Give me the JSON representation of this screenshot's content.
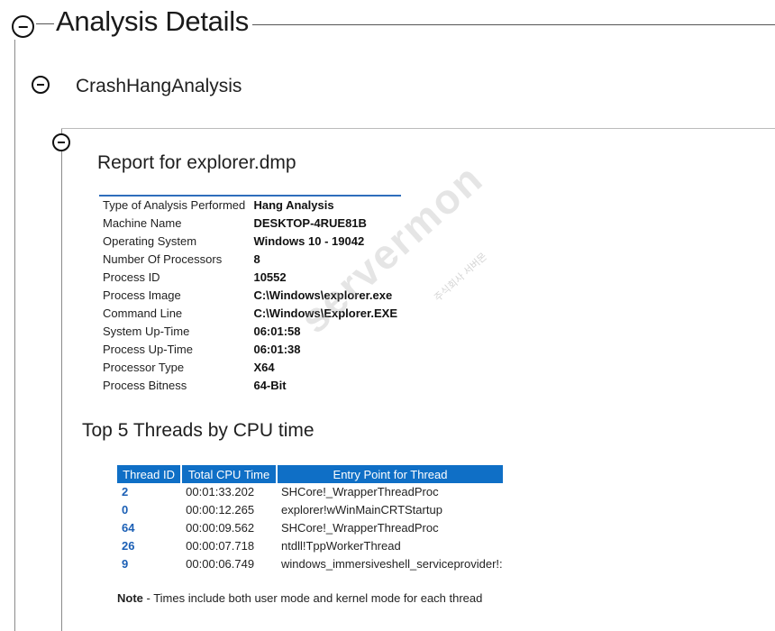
{
  "section": {
    "title": "Analysis Details",
    "subsection": "CrashHangAnalysis",
    "report_title": "Report for explorer.dmp"
  },
  "info": [
    {
      "label": "Type of Analysis Performed",
      "value": "Hang Analysis"
    },
    {
      "label": "Machine Name",
      "value": "DESKTOP-4RUE81B"
    },
    {
      "label": "Operating System",
      "value": "Windows 10 - 19042"
    },
    {
      "label": "Number Of Processors",
      "value": "8"
    },
    {
      "label": "Process ID",
      "value": "10552"
    },
    {
      "label": "Process Image",
      "value": "C:\\Windows\\explorer.exe"
    },
    {
      "label": "Command Line",
      "value": "C:\\Windows\\Explorer.EXE"
    },
    {
      "label": "System Up-Time",
      "value": "06:01:58"
    },
    {
      "label": "Process Up-Time",
      "value": "06:01:38"
    },
    {
      "label": "Processor Type",
      "value": "X64"
    },
    {
      "label": "Process Bitness",
      "value": "64-Bit"
    }
  ],
  "threads": {
    "title": "Top 5 Threads by CPU time",
    "headers": [
      "Thread ID",
      "Total CPU Time",
      "Entry Point for Thread"
    ],
    "rows": [
      {
        "id": "2",
        "time": "00:01:33.202",
        "entry": "SHCore!_WrapperThreadProc"
      },
      {
        "id": "0",
        "time": "00:00:12.265",
        "entry": "explorer!wWinMainCRTStartup"
      },
      {
        "id": "64",
        "time": "00:00:09.562",
        "entry": "SHCore!_WrapperThreadProc"
      },
      {
        "id": "26",
        "time": "00:00:07.718",
        "entry": "ntdll!TppWorkerThread"
      },
      {
        "id": "9",
        "time": "00:00:06.749",
        "entry": "windows_immersiveshell_serviceprovider!::"
      }
    ]
  },
  "note": {
    "bold": "Note",
    "text": " - Times include both user mode and kernel mode for each thread"
  },
  "watermark": {
    "text": "servermon",
    "sub": "주식회사 서버몬"
  },
  "colors": {
    "table_header": "#0f6fc6",
    "thread_id": "#1b5fb5",
    "info_border": "#2f6ebc"
  }
}
